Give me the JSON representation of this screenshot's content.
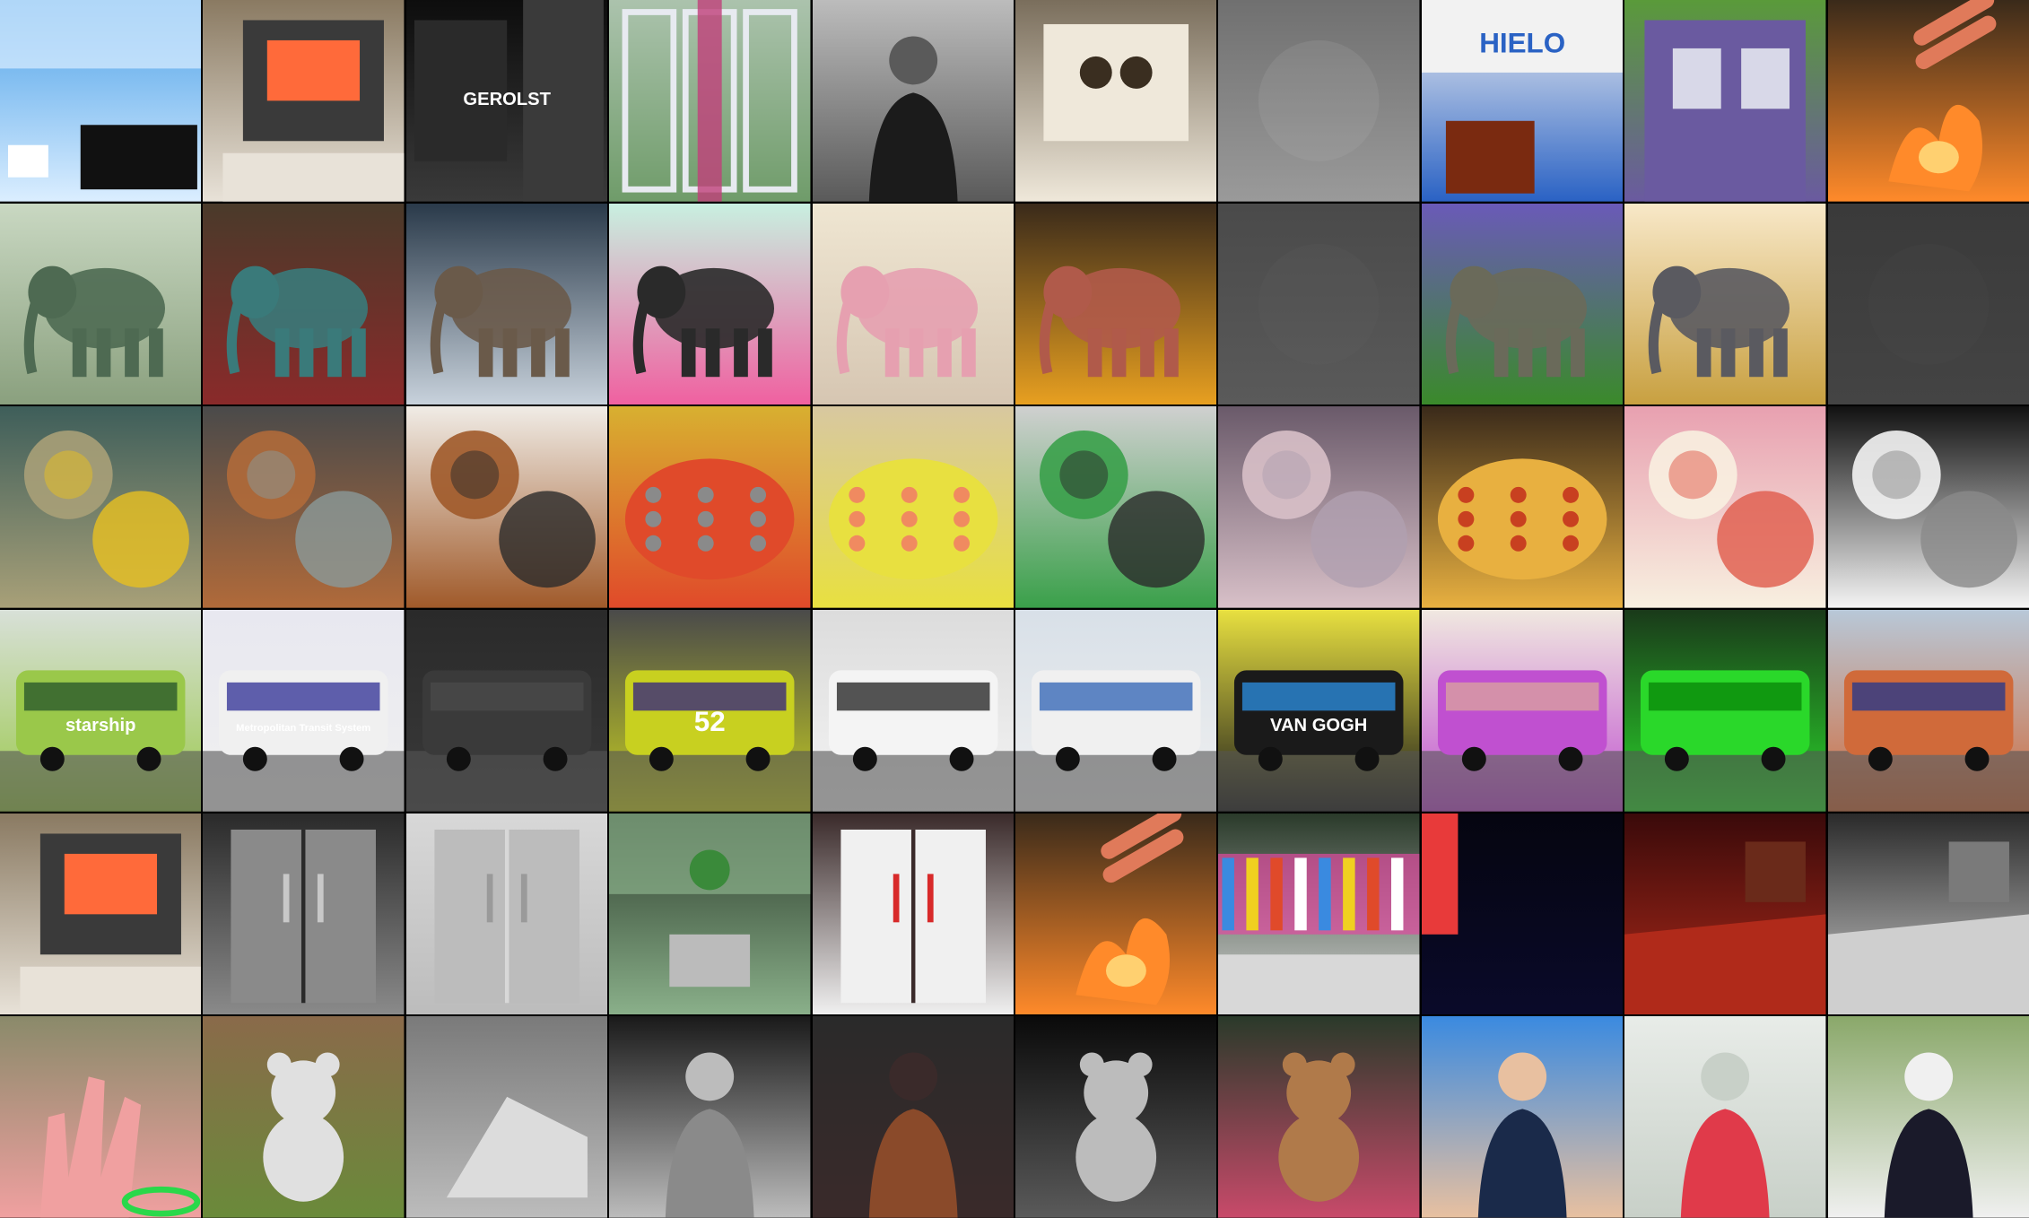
{
  "grid": {
    "rows": 6,
    "cols": 10
  },
  "tiles": [
    {
      "kind": "screen",
      "c1": "#4aa0e8",
      "c2": "#dbeeff",
      "a": "#111111",
      "label": ""
    },
    {
      "kind": "oven",
      "c1": "#8a7a62",
      "c2": "#e8e2d8",
      "a": "#ff6a3a",
      "label": ""
    },
    {
      "kind": "bottle",
      "c1": "#0d0d0d",
      "c2": "#3a3a3a",
      "a": "#aaaaaa",
      "label": "GEROLST"
    },
    {
      "kind": "window",
      "c1": "#e7eaf0",
      "c2": "#6f9c6a",
      "a": "#c0407a",
      "label": ""
    },
    {
      "kind": "person",
      "c1": "#bcbcbc",
      "c2": "#5a5a5a",
      "a": "#1b1b1b",
      "label": ""
    },
    {
      "kind": "frame",
      "c1": "#7a6e5c",
      "c2": "#efe8da",
      "a": "#3a2e20",
      "label": ""
    },
    {
      "kind": "plain",
      "c1": "#707070",
      "c2": "#9a9a9a",
      "a": "#bbbbbb",
      "label": ""
    },
    {
      "kind": "sign",
      "c1": "#f2f2f2",
      "c2": "#2a62c4",
      "a": "#7a2a10",
      "label": "HIELO"
    },
    {
      "kind": "house",
      "c1": "#5a9a3a",
      "c2": "#6a5aa0",
      "a": "#ffffff",
      "label": ""
    },
    {
      "kind": "fire",
      "c1": "#3a2a1a",
      "c2": "#ff8a2a",
      "a": "#ffd070",
      "label": ""
    },
    {
      "kind": "elephant",
      "c1": "#c9d8c2",
      "c2": "#8aa07e",
      "a": "#4e6a52",
      "label": ""
    },
    {
      "kind": "elephant",
      "c1": "#4a3a2a",
      "c2": "#8a2a2a",
      "a": "#3a7a7a",
      "label": ""
    },
    {
      "kind": "elephant",
      "c1": "#2a3a4a",
      "c2": "#c8d2dc",
      "a": "#6a5a4a",
      "label": ""
    },
    {
      "kind": "elephant",
      "c1": "#c8f0e0",
      "c2": "#f060a0",
      "a": "#2a2a2a",
      "label": ""
    },
    {
      "kind": "elephant",
      "c1": "#efe6d2",
      "c2": "#d6c6b2",
      "a": "#e6a0b0",
      "label": ""
    },
    {
      "kind": "elephant",
      "c1": "#3a2a1a",
      "c2": "#e8a020",
      "a": "#b05a4a",
      "label": ""
    },
    {
      "kind": "plain",
      "c1": "#4a4a4a",
      "c2": "#5a5a5a",
      "a": "#686868",
      "label": ""
    },
    {
      "kind": "elephant",
      "c1": "#6a5ab8",
      "c2": "#3a8a2a",
      "a": "#6a6a5a",
      "label": ""
    },
    {
      "kind": "elephant",
      "c1": "#f8e8c8",
      "c2": "#c8a040",
      "a": "#5a5a60",
      "label": ""
    },
    {
      "kind": "plain",
      "c1": "#3a3a3a",
      "c2": "#444444",
      "a": "#4e4e4e",
      "label": ""
    },
    {
      "kind": "food",
      "c1": "#3e5e5a",
      "c2": "#a8a078",
      "a": "#e8c020",
      "label": ""
    },
    {
      "kind": "food",
      "c1": "#4a4a4a",
      "c2": "#b06a3a",
      "a": "#8a9a9a",
      "label": ""
    },
    {
      "kind": "food",
      "c1": "#f0ece6",
      "c2": "#a05a2a",
      "a": "#2a2a2a",
      "label": ""
    },
    {
      "kind": "pizza",
      "c1": "#d8b030",
      "c2": "#e04a2a",
      "a": "#8a8a8a",
      "label": ""
    },
    {
      "kind": "pizza",
      "c1": "#d8c8a0",
      "c2": "#e8e040",
      "a": "#f08a60",
      "label": ""
    },
    {
      "kind": "food",
      "c1": "#d0d0d0",
      "c2": "#3aa04a",
      "a": "#2a2a2a",
      "label": ""
    },
    {
      "kind": "food",
      "c1": "#6a5a6a",
      "c2": "#d8c0c8",
      "a": "#b0a0b0",
      "label": ""
    },
    {
      "kind": "pizza",
      "c1": "#3a2a1a",
      "c2": "#e8b040",
      "a": "#c84020",
      "label": ""
    },
    {
      "kind": "food",
      "c1": "#e8a0b0",
      "c2": "#f8f0e0",
      "a": "#e05a4a",
      "label": ""
    },
    {
      "kind": "food",
      "c1": "#111111",
      "c2": "#f4f4f4",
      "a": "#8a8a8a",
      "label": ""
    },
    {
      "kind": "bus",
      "c1": "#d8e0d8",
      "c2": "#9ac84a",
      "a": "#2a5a2a",
      "label": "starship"
    },
    {
      "kind": "bus",
      "c1": "#e8e8f0",
      "c2": "#f0f0f0",
      "a": "#3a3a9a",
      "label": "Metropolitan Transit System"
    },
    {
      "kind": "bus",
      "c1": "#2a2a2a",
      "c2": "#3a3a3a",
      "a": "#4a4a4a",
      "label": ""
    },
    {
      "kind": "bus",
      "c1": "#4a4a4a",
      "c2": "#c8d020",
      "a": "#3a2a7a",
      "label": "52"
    },
    {
      "kind": "bus",
      "c1": "#dcdcdc",
      "c2": "#f4f4f4",
      "a": "#2a2a2a",
      "label": ""
    },
    {
      "kind": "bus",
      "c1": "#d8e0e8",
      "c2": "#f0f0f0",
      "a": "#3a6ab8",
      "label": ""
    },
    {
      "kind": "bus",
      "c1": "#e8e040",
      "c2": "#1a1a1a",
      "a": "#2a8ad8",
      "label": "VAN GOGH"
    },
    {
      "kind": "bus",
      "c1": "#f0e8e0",
      "c2": "#c050d0",
      "a": "#d8a0a0",
      "label": ""
    },
    {
      "kind": "bus",
      "c1": "#1a3a1a",
      "c2": "#2ad82a",
      "a": "#0a8a0a",
      "label": ""
    },
    {
      "kind": "bus",
      "c1": "#b8c8d8",
      "c2": "#d06a3a",
      "a": "#2a3a8a",
      "label": ""
    },
    {
      "kind": "oven",
      "c1": "#8a7a62",
      "c2": "#e8e2d8",
      "a": "#ff6a3a",
      "label": ""
    },
    {
      "kind": "fridge",
      "c1": "#2a2a2a",
      "c2": "#8a8a8a",
      "a": "#c8c8c8",
      "label": ""
    },
    {
      "kind": "fridge",
      "c1": "#d8d8d8",
      "c2": "#bcbcbc",
      "a": "#9a9a9a",
      "label": ""
    },
    {
      "kind": "laptop",
      "c1": "#2a3a2a",
      "c2": "#8ab08a",
      "a": "#3a8a3a",
      "label": ""
    },
    {
      "kind": "fridge",
      "c1": "#3a2a2a",
      "c2": "#f0f0f0",
      "a": "#d82a2a",
      "label": ""
    },
    {
      "kind": "fire",
      "c1": "#3a2a1a",
      "c2": "#ff8a2a",
      "a": "#ffd070",
      "label": ""
    },
    {
      "kind": "bench",
      "c1": "#2a3a2a",
      "c2": "#d8d8d8",
      "a": "#e04aa0",
      "label": ""
    },
    {
      "kind": "dark",
      "c1": "#050510",
      "c2": "#0a0a2a",
      "a": "#e83a3a",
      "label": ""
    },
    {
      "kind": "room",
      "c1": "#3a0a0a",
      "c2": "#b02a1a",
      "a": "#6a2a1a",
      "label": ""
    },
    {
      "kind": "room",
      "c1": "#2a2a2a",
      "c2": "#cfcfcf",
      "a": "#7a7a7a",
      "label": ""
    },
    {
      "kind": "hand",
      "c1": "#8a8a6a",
      "c2": "#f0a0a0",
      "a": "#2ad84a",
      "label": ""
    },
    {
      "kind": "bear",
      "c1": "#8a6a4a",
      "c2": "#6a8a3a",
      "a": "#e0e0e0",
      "label": ""
    },
    {
      "kind": "tent",
      "c1": "#7a7a7a",
      "c2": "#bcbcbc",
      "a": "#dcdcdc",
      "label": ""
    },
    {
      "kind": "person",
      "c1": "#1a1a1a",
      "c2": "#bcbcbc",
      "a": "#8a8a8a",
      "label": ""
    },
    {
      "kind": "person",
      "c1": "#2a2a2a",
      "c2": "#3a2a2a",
      "a": "#8a4a2a",
      "label": ""
    },
    {
      "kind": "bear",
      "c1": "#0a0a0a",
      "c2": "#5a5a5a",
      "a": "#bcbcbc",
      "label": ""
    },
    {
      "kind": "bear",
      "c1": "#2a3a2a",
      "c2": "#c84a6a",
      "a": "#b07a4a",
      "label": ""
    },
    {
      "kind": "person",
      "c1": "#3a8ae0",
      "c2": "#e8c0a0",
      "a": "#1a2a4a",
      "label": ""
    },
    {
      "kind": "person",
      "c1": "#e8ece8",
      "c2": "#c8d0c8",
      "a": "#e03a4a",
      "label": ""
    },
    {
      "kind": "person",
      "c1": "#8aa86a",
      "c2": "#f0f0f0",
      "a": "#1a1a2a",
      "label": ""
    }
  ]
}
